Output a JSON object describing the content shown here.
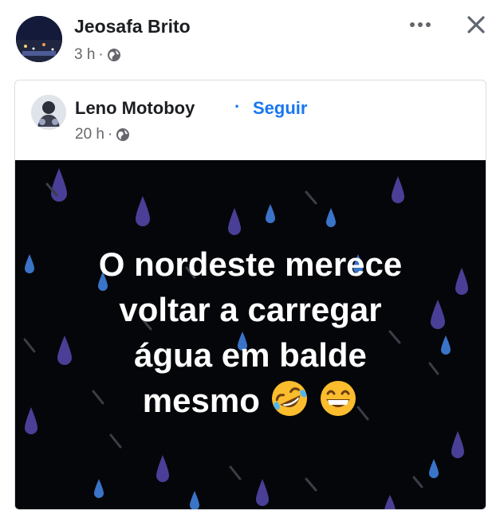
{
  "post": {
    "author": "Jeosafa Brito",
    "time": "3 h",
    "meta_separator": "·"
  },
  "shared_post": {
    "author": "Leno Motoboy",
    "separator": "·",
    "follow_label": "Seguir",
    "time": "20 h",
    "meta_separator": "·",
    "image_text_lines": [
      "O nordeste merece",
      "voltar a carregar",
      "água em balde",
      "mesmo"
    ],
    "emojis": [
      "rolling-on-floor-laughing",
      "grinning-face"
    ]
  },
  "colors": {
    "follow": "#1877f2",
    "meta": "#65676b",
    "image_bg": "#05060a",
    "drop": "#3f3a8a"
  }
}
